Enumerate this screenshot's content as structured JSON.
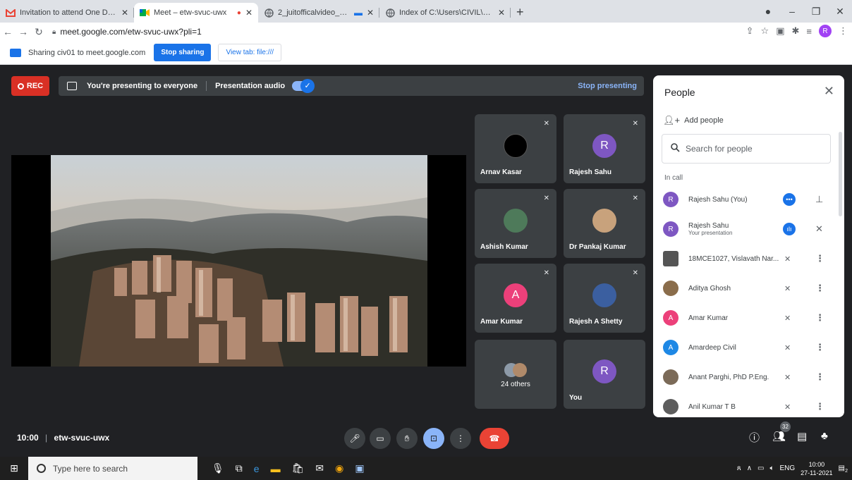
{
  "browser": {
    "tabs": [
      {
        "title": "Invitation to attend One Day web",
        "icon": "gmail-icon"
      },
      {
        "title": "Meet – etw-svuc-uwx",
        "icon": "meet-icon"
      },
      {
        "title": "2_juitofficalvideo_new.mp4",
        "icon": "globe-icon"
      },
      {
        "title": "Index of C:\\Users\\CIVIL\\Desktop\\",
        "icon": "globe-icon"
      }
    ],
    "url": "meet.google.com/etw-svuc-uwx?pli=1",
    "profile_initial": "R"
  },
  "sharing_bar": {
    "text": "Sharing civ01 to meet.google.com",
    "stop_label": "Stop sharing",
    "view_label": "View tab: file:///"
  },
  "meet": {
    "rec_label": "REC",
    "presenting_text": "You're presenting to everyone",
    "audio_label": "Presentation audio",
    "stop_presenting_label": "Stop presenting",
    "tiles": [
      {
        "name": "Arnav Kasar",
        "avatar": "",
        "color": "#000000"
      },
      {
        "name": "Rajesh Sahu",
        "avatar": "R",
        "color": "#7e57c2"
      },
      {
        "name": "Ashish Kumar",
        "avatar": "",
        "color": "#4e7a5a"
      },
      {
        "name": "Dr Pankaj Kumar",
        "avatar": "",
        "color": "#c8a27c"
      },
      {
        "name": "Amar Kumar",
        "avatar": "A",
        "color": "#ec407a"
      },
      {
        "name": "Rajesh A Shetty",
        "avatar": "",
        "color": "#3b5fa0"
      },
      {
        "name": "",
        "avatar": "",
        "color": "#8d9aa8",
        "others": "24 others"
      },
      {
        "name": "You",
        "avatar": "R",
        "color": "#7e57c2"
      }
    ],
    "time": "10:00",
    "meeting_code": "etw-svuc-uwx",
    "participant_count": "32"
  },
  "people_panel": {
    "title": "People",
    "add_people_label": "Add people",
    "search_placeholder": "Search for people",
    "in_call_label": "In call",
    "participants": [
      {
        "name": "Rajesh Sahu (You)",
        "sub": "",
        "initial": "R",
        "color": "#7e57c2",
        "kind": "self"
      },
      {
        "name": "Rajesh Sahu",
        "sub": "Your presentation",
        "initial": "R",
        "color": "#7e57c2",
        "kind": "presentation"
      },
      {
        "name": "18MCE1027, Vislavath Nar...",
        "sub": "",
        "initial": "",
        "color": "#555555",
        "kind": "normal"
      },
      {
        "name": "Aditya Ghosh",
        "sub": "",
        "initial": "",
        "color": "#8a6d4b",
        "kind": "normal"
      },
      {
        "name": "Amar Kumar",
        "sub": "",
        "initial": "A",
        "color": "#ec407a",
        "kind": "normal"
      },
      {
        "name": "Amardeep Civil",
        "sub": "",
        "initial": "A",
        "color": "#1e88e5",
        "kind": "normal"
      },
      {
        "name": "Anant Parghi, PhD P.Eng.",
        "sub": "",
        "initial": "",
        "color": "#7b6a58",
        "kind": "normal"
      },
      {
        "name": "Anil Kumar T B",
        "sub": "",
        "initial": "",
        "color": "#5d5d5d",
        "kind": "normal"
      }
    ]
  },
  "taskbar": {
    "search_placeholder": "Type here to search",
    "lang": "ENG",
    "clock_time": "10:00",
    "clock_date": "27-11-2021",
    "notification_count": "2"
  }
}
